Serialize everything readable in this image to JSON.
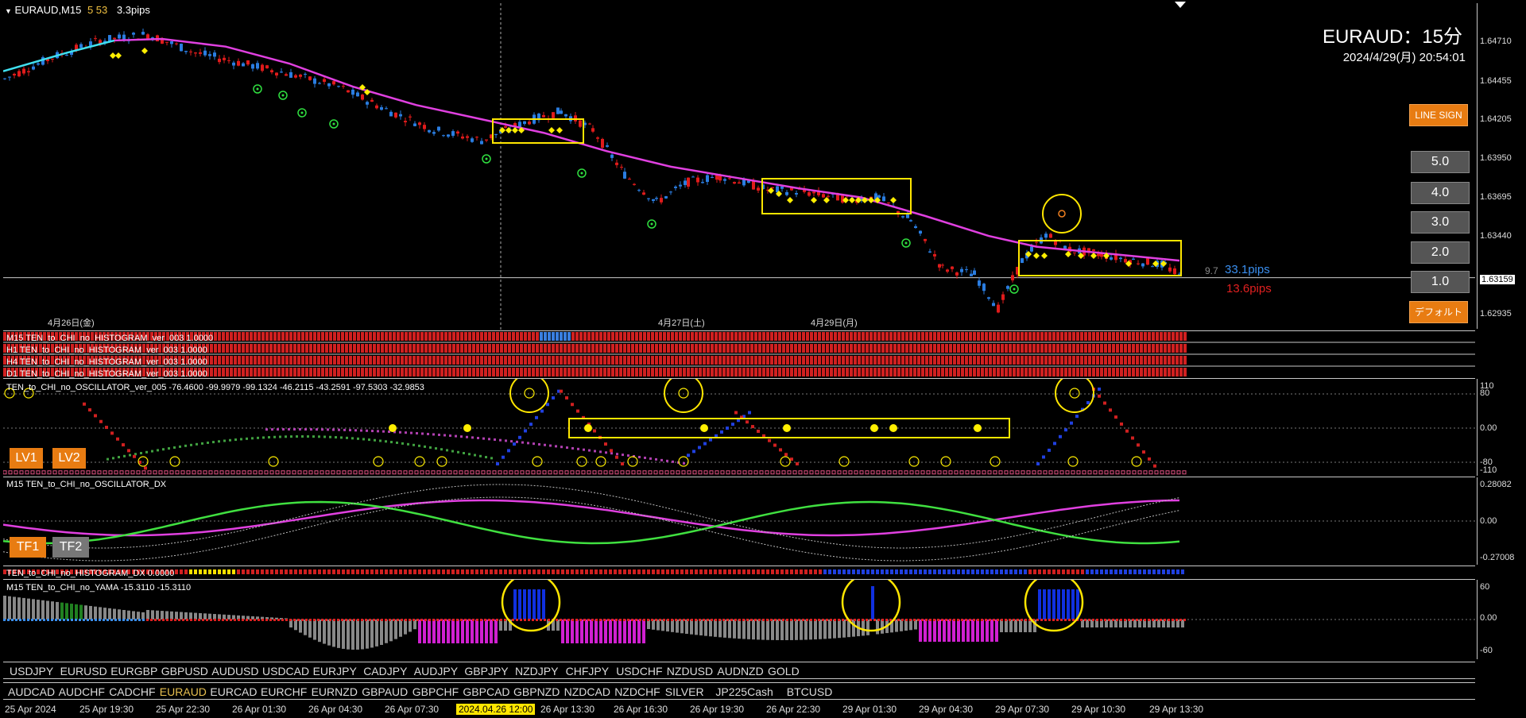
{
  "header": {
    "symbol_tf": "EURAUD,M15",
    "icons_text": "5 53",
    "spread_text": "3.3pips",
    "big_title": "EURAUD：15分",
    "datetime": "2024/4/29(月) 20:54:01"
  },
  "price_axis": [
    "1.64710",
    "1.64455",
    "1.64205",
    "1.63950",
    "1.63695",
    "1.63440",
    "1.63159",
    "1.62935"
  ],
  "current_price": "1.63159",
  "pips": {
    "small": "9.7",
    "blue": "33.1pips",
    "red": "13.6pips"
  },
  "buttons": {
    "line_sign": "LINE SIGN",
    "levels": [
      "5.0",
      "4.0",
      "3.0",
      "2.0",
      "1.0"
    ],
    "default": "デフォルト",
    "lv1": "LV1",
    "lv2": "LV2",
    "tf1": "TF1",
    "tf2": "TF2"
  },
  "date_labels": [
    "4月26日(金)",
    "4月27日(土)",
    "4月29日(月)"
  ],
  "histograms": [
    "M15 TEN_to_CHI_no_HISTOGRAM_ver_003 1.0000",
    "H1 TEN_to_CHI_no_HISTOGRAM_ver_003 1.0000",
    "H4 TEN_to_CHI_no_HISTOGRAM_ver_003 1.0000",
    "D1 TEN_to_CHI_no_HISTOGRAM_ver_003 1.0000"
  ],
  "oscillator": {
    "title": "TEN_to_CHI_no_OSCILLATOR_ver_005 -76.4600 -99.9979 -99.1324 -46.2115 -43.2591 -97.5303 -32.9853",
    "axis": [
      "110",
      "80",
      "0.00",
      "-80",
      "-110"
    ]
  },
  "oscillator_dx": {
    "title": "M15 TEN_to_CHI_no_OSCILLATOR_DX",
    "axis": [
      "0.28082",
      "0.00",
      "-0.27008"
    ]
  },
  "histogram_dx": {
    "title": "TEN_to_CHI_no_HISTOGRAM_DX 0.0000"
  },
  "yama": {
    "title": "M15 TEN_to_CHI_no_YAMA -15.3110 -15.3110",
    "axis": [
      "60",
      "0.00",
      "-60"
    ]
  },
  "symbols_row1": [
    "USDJPY",
    "EURUSD",
    "EURGBP",
    "GBPUSD",
    "AUDUSD",
    "USDCAD",
    "EURJPY",
    "CADJPY",
    "AUDJPY",
    "GBPJPY",
    "NZDJPY",
    "CHFJPY",
    "USDCHF",
    "NZDUSD",
    "AUDNZD",
    "GOLD"
  ],
  "symbols_row2": [
    "AUDCAD",
    "AUDCHF",
    "CADCHF",
    "EURAUD",
    "EURCAD",
    "EURCHF",
    "EURNZD",
    "GBPAUD",
    "GBPCHF",
    "GBPCAD",
    "GBPNZD",
    "NZDCAD",
    "NZDCHF",
    "SILVER",
    "JP225Cash",
    "BTCUSD"
  ],
  "active_symbol": "EURAUD",
  "time_axis": [
    "25 Apr 2024",
    "25 Apr 19:30",
    "25 Apr 22:30",
    "26 Apr 01:30",
    "26 Apr 04:30",
    "26 Apr 07:30",
    "2024.04.26 12:00",
    "26 Apr 13:30",
    "26 Apr 16:30",
    "26 Apr 19:30",
    "26 Apr 22:30",
    "29 Apr 01:30",
    "29 Apr 04:30",
    "29 Apr 07:30",
    "29 Apr 10:30",
    "29 Apr 13:30"
  ],
  "colors": {
    "bull": "#2a7de1",
    "bear": "#e01b1b",
    "ma": "#e040e0",
    "ma_early": "#40e0f0",
    "signal": "#ffee00",
    "highlight": "#ffe600"
  }
}
